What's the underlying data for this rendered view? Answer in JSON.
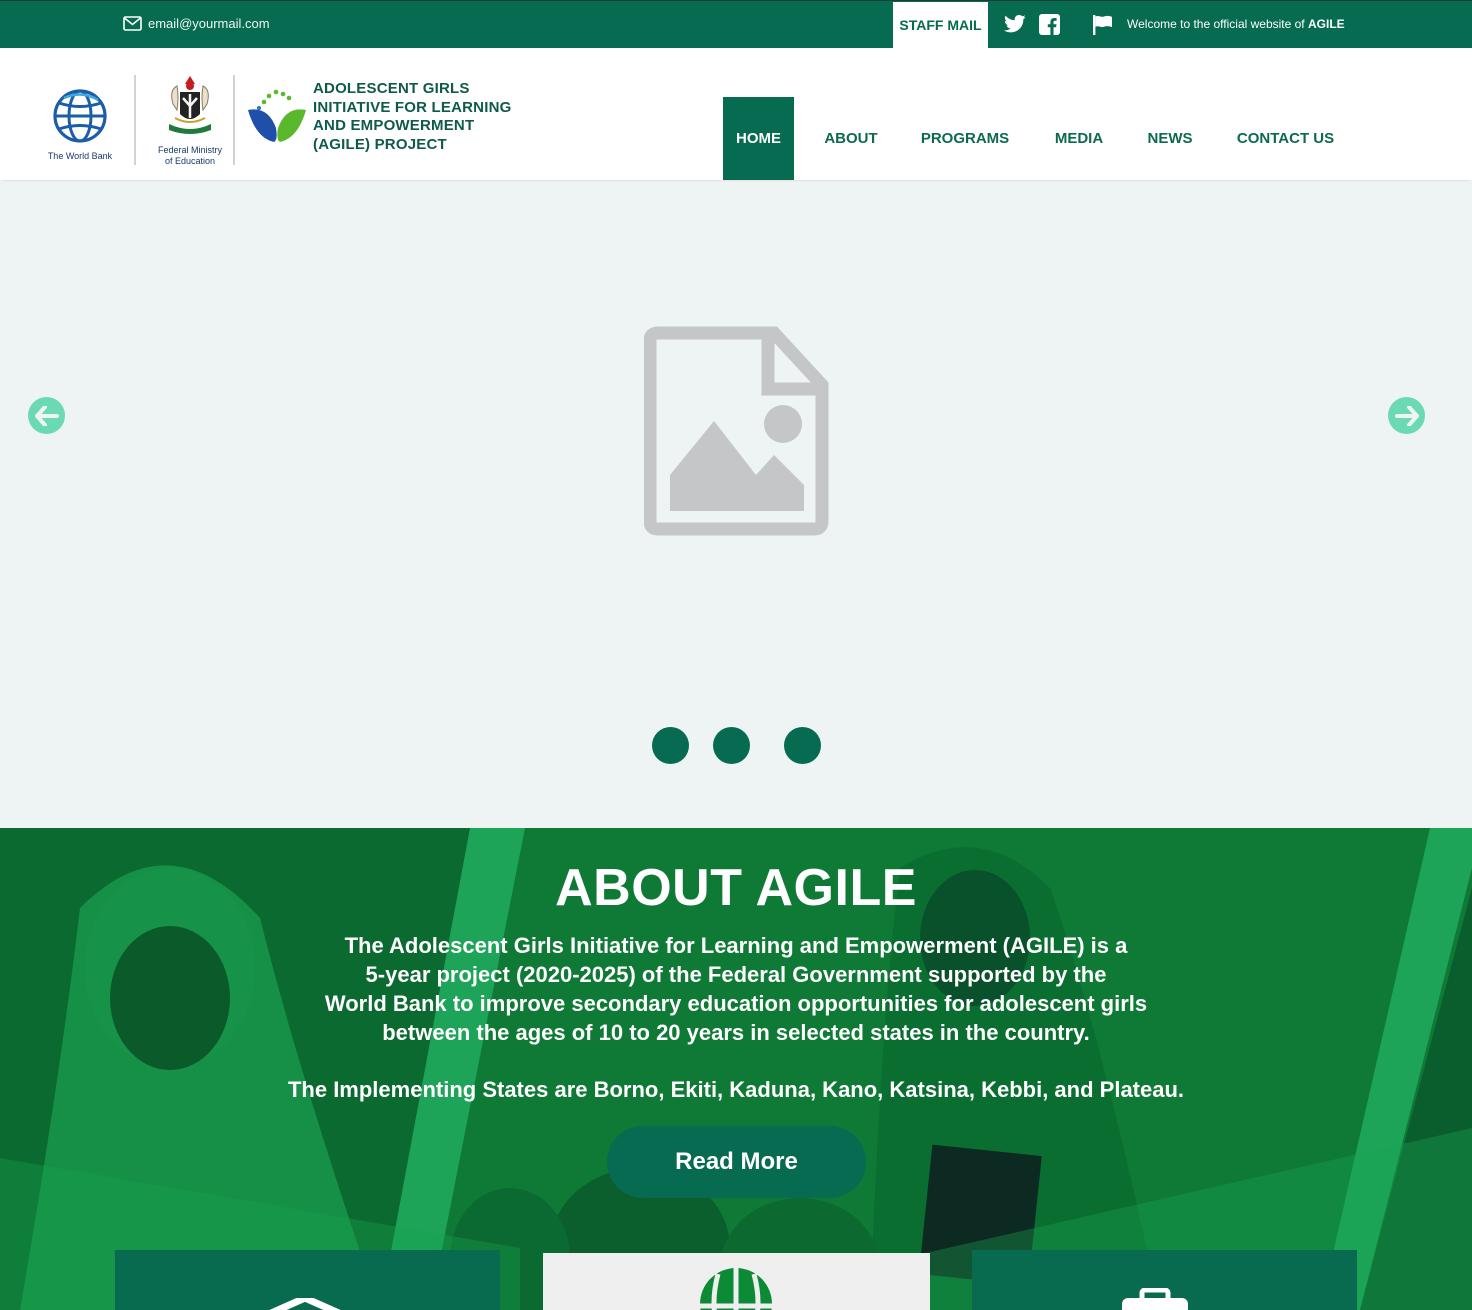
{
  "topbar": {
    "email": "email@yourmail.com",
    "staff_mail": "STAFF MAIL",
    "welcome_prefix": "Welcome to the official website of ",
    "welcome_brand": "AGILE"
  },
  "header": {
    "worldbank_label": "The World Bank",
    "fme_label_line1": "Federal Ministry",
    "fme_label_line2": "of Education",
    "agile_title_1": "ADOLESCENT GIRLS",
    "agile_title_2": "INITIATIVE FOR LEARNING",
    "agile_title_3": "AND EMPOWERMENT",
    "agile_title_4": "(AGILE) PROJECT"
  },
  "nav": {
    "items": [
      {
        "label": "HOME",
        "active": true
      },
      {
        "label": "ABOUT"
      },
      {
        "label": "PROGRAMS"
      },
      {
        "label": "MEDIA"
      },
      {
        "label": "NEWS"
      },
      {
        "label": "CONTACT US"
      }
    ]
  },
  "hero": {
    "placeholder_icon": "image-placeholder-icon",
    "prev_icon": "arrow-left-circle-icon",
    "next_icon": "arrow-right-circle-icon",
    "slide_count": 3
  },
  "about": {
    "title": "ABOUT AGILE",
    "line1": "The Adolescent Girls Initiative for Learning and Empowerment (AGILE) is a",
    "line2": "5-year project (2020-2025) of the Federal Government supported by the",
    "line3": "World Bank to improve secondary education opportunities for adolescent girls",
    "line4": "between the ages of 10 to 20 years in selected states in the country.",
    "states": "The Implementing States are Borno, Ekiti, Kaduna, Kano, Katsina, Kebbi, and Plateau.",
    "read_more": "Read More"
  },
  "colors": {
    "brand_green": "#066b50",
    "hero_bg": "#eef4f3",
    "arrow_accent": "#6bd9b4",
    "about_green": "#0f7a37"
  }
}
